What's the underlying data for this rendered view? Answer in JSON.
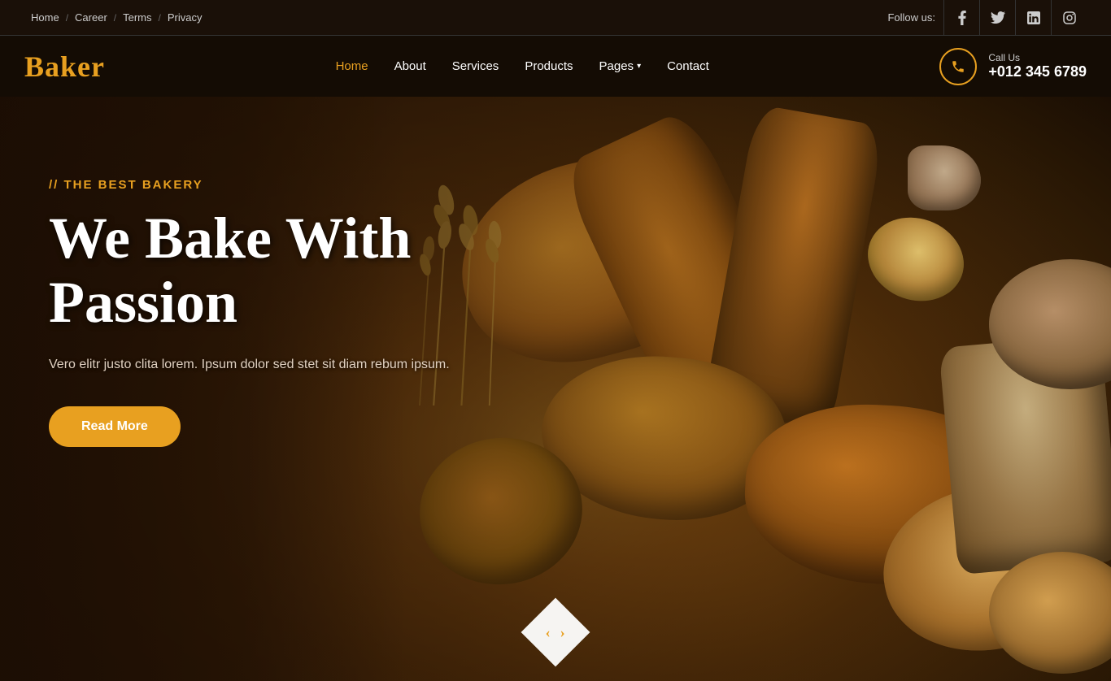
{
  "topbar": {
    "links": [
      {
        "label": "Home",
        "id": "home"
      },
      {
        "label": "Career",
        "id": "career"
      },
      {
        "label": "Terms",
        "id": "terms"
      },
      {
        "label": "Privacy",
        "id": "privacy"
      }
    ],
    "follow_label": "Follow us:",
    "social": [
      {
        "name": "facebook",
        "icon": "f"
      },
      {
        "name": "twitter",
        "icon": "t"
      },
      {
        "name": "linkedin",
        "icon": "in"
      },
      {
        "name": "instagram",
        "icon": "📷"
      }
    ]
  },
  "navbar": {
    "logo": "Baker",
    "links": [
      {
        "label": "Home",
        "active": true,
        "id": "home"
      },
      {
        "label": "About",
        "active": false,
        "id": "about"
      },
      {
        "label": "Services",
        "active": false,
        "id": "services"
      },
      {
        "label": "Products",
        "active": false,
        "id": "products"
      },
      {
        "label": "Pages",
        "active": false,
        "id": "pages",
        "dropdown": true
      },
      {
        "label": "Contact",
        "active": false,
        "id": "contact"
      }
    ],
    "call_label": "Call Us",
    "call_number": "+012 345 6789"
  },
  "hero": {
    "subtitle": "// THE BEST BAKERY",
    "title_line1": "We Bake With",
    "title_line2": "Passion",
    "description": "Vero elitr justo clita lorem. Ipsum dolor sed stet sit diam rebum ipsum.",
    "cta_label": "Read More",
    "accent_color": "#e8a020"
  }
}
